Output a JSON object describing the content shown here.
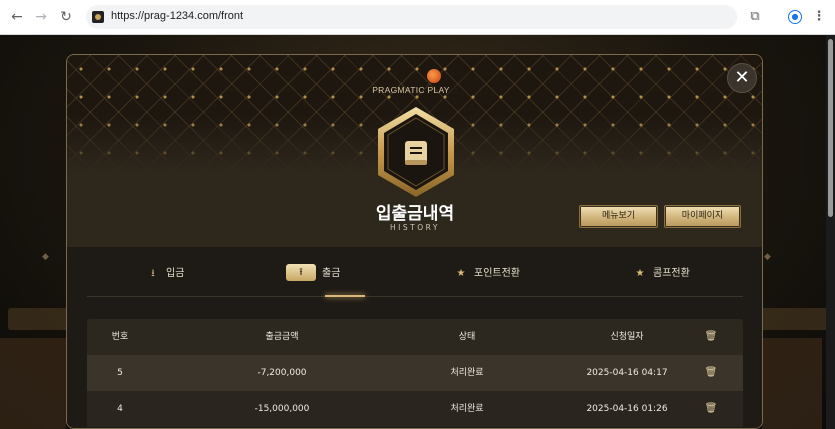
{
  "browser": {
    "url": "https://prag-1234.com/front",
    "icons": [
      "back-arrow-icon",
      "forward-arrow-icon",
      "reload-icon",
      "extensions-icon",
      "profile-icon",
      "more-menu-icon"
    ]
  },
  "modal": {
    "logo_text": "PRAGMATIC PLAY",
    "close_symbol": "✕",
    "title": "입출금내역",
    "subtitle": "HISTORY",
    "buttons": {
      "menu": "메뉴보기",
      "mypage": "마이페이지"
    },
    "tabs": [
      {
        "label": "입금",
        "icon": "download-icon",
        "active": false
      },
      {
        "label": "출금",
        "icon": "upload-icon",
        "active": true
      },
      {
        "label": "포인트전환",
        "icon": "star-icon",
        "active": false
      },
      {
        "label": "콤프전환",
        "icon": "star-icon",
        "active": false
      }
    ],
    "table": {
      "headers": [
        "번호",
        "출금금액",
        "상태",
        "신청일자"
      ],
      "rows": [
        {
          "no": "5",
          "amount": "-7,200,000",
          "status": "처리완료",
          "date": "2025-04-16 04:17"
        },
        {
          "no": "4",
          "amount": "-15,000,000",
          "status": "처리완료",
          "date": "2025-04-16 01:26"
        }
      ]
    }
  },
  "colors": {
    "gold": "#d9b875",
    "panel": "#1e1a15",
    "header": "#2e271c"
  }
}
